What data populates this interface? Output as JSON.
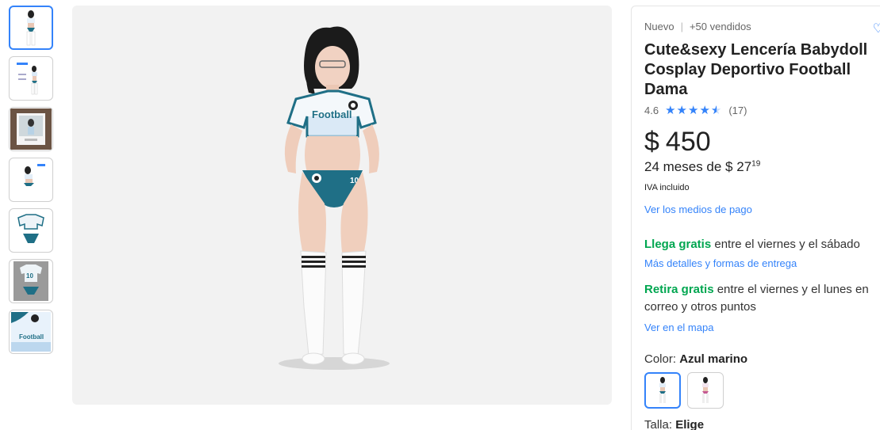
{
  "gallery": {
    "thumbnails": [
      {
        "name": "thumb-model-front",
        "active": true
      },
      {
        "name": "thumb-model-collage",
        "active": false
      },
      {
        "name": "thumb-polaroid",
        "active": false
      },
      {
        "name": "thumb-model-pose",
        "active": false
      },
      {
        "name": "thumb-set-flat",
        "active": false
      },
      {
        "name": "thumb-jersey-10",
        "active": false
      },
      {
        "name": "thumb-top-closeup",
        "active": false
      }
    ],
    "main_image_text": "Football"
  },
  "product": {
    "condition": "Nuevo",
    "sold": "+50 vendidos",
    "title": "Cute&sexy Lencería Babydoll Cosplay Deportivo Football Dama",
    "rating": "4.6",
    "reviews": "(17)",
    "currency": "$",
    "price": "450",
    "installments_prefix": "24 meses de $ 27",
    "installments_cents": "19",
    "iva": "IVA incluido",
    "payment_link": "Ver los medios de pago"
  },
  "shipping": {
    "arrive_green": "Llega gratis",
    "arrive_text": " entre el viernes y el sábado",
    "arrive_link": "Más detalles y formas de entrega",
    "pickup_green": "Retira gratis",
    "pickup_text": " entre el viernes y el lunes en correo y otros puntos",
    "pickup_link": "Ver en el mapa"
  },
  "variants": {
    "color_label": "Color: ",
    "color_value": "Azul marino",
    "size_label": "Talla: ",
    "size_value": "Elige"
  },
  "colors": {
    "accent": "#3483fa",
    "green": "#00a650",
    "jersey_blue": "#1f6f86"
  }
}
